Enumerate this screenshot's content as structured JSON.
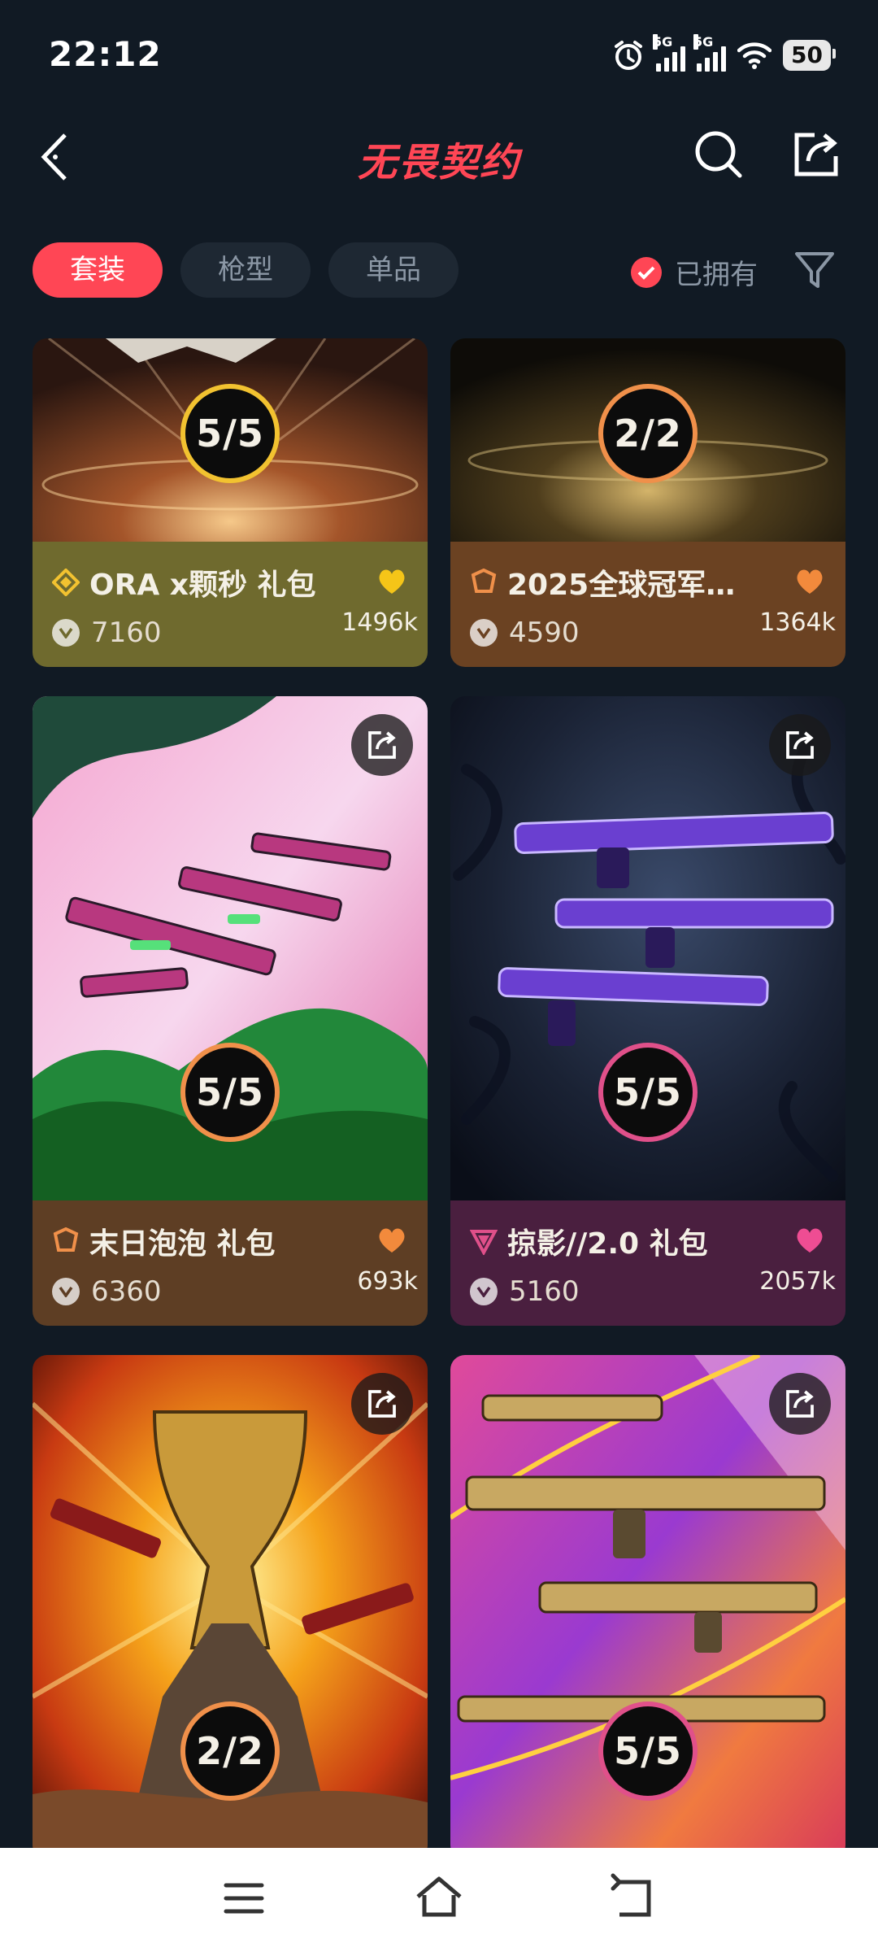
{
  "status": {
    "time": "22:12",
    "net1": "5G",
    "net2": "5G",
    "battery": "50"
  },
  "header": {
    "title": "无畏契约"
  },
  "filters": {
    "tabs": [
      {
        "label": "套装",
        "active": true
      },
      {
        "label": "枪型",
        "active": false
      },
      {
        "label": "单品",
        "active": false
      }
    ],
    "owned_label": "已拥有"
  },
  "bundles": [
    {
      "name": "ORA x颗秒 礼包",
      "price": "7160",
      "likes": "1496k",
      "progress": "5/5",
      "progress_shown": "5",
      "progress_total": "5",
      "tier_color": "#f2c230",
      "heart_color": "#f5c518",
      "info_bg": "#6f6a2e"
    },
    {
      "name": "2025全球冠军…",
      "price": "4590",
      "likes": "1364k",
      "progress": "2/2",
      "progress_shown": "2",
      "progress_total": "2",
      "tier_color": "#f0904a",
      "heart_color": "#f28a3c",
      "info_bg": "#6b4222"
    },
    {
      "name": "末日泡泡 礼包",
      "price": "6360",
      "likes": "693k",
      "progress": "5/5",
      "progress_shown": "5",
      "progress_total": "5",
      "tier_color": "#f0904a",
      "heart_color": "#f28a3c",
      "info_bg": "#5e3e24"
    },
    {
      "name": "掠影//2.0 礼包",
      "price": "5160",
      "likes": "2057k",
      "progress": "5/5",
      "progress_shown": "5",
      "progress_total": "5",
      "tier_color": "#e0508a",
      "heart_color": "#ee4d93",
      "info_bg": "#4a1f3f"
    },
    {
      "progress": "2/2",
      "progress_shown": "2",
      "progress_total": "2",
      "tier_color": "#f0904a"
    },
    {
      "progress": "5/5",
      "progress_shown": "5",
      "progress_total": "5",
      "tier_color": "#e0508a"
    }
  ],
  "navbar": {
    "icons": [
      "menu-icon",
      "home-icon",
      "back-icon"
    ]
  }
}
